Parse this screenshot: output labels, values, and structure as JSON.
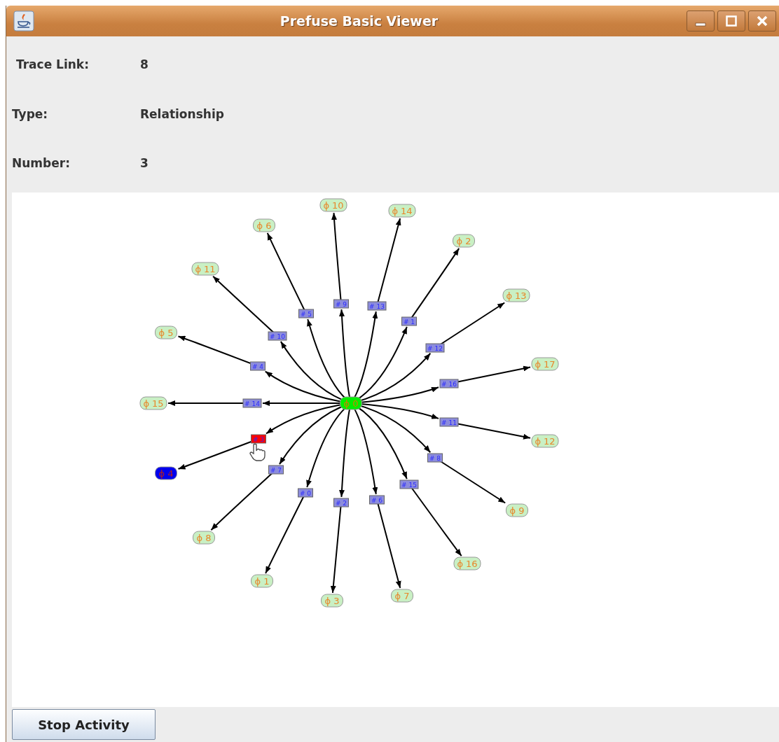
{
  "window": {
    "title": "Prefuse Basic Viewer"
  },
  "fields": [
    {
      "label": "Trace Link:",
      "value": "8"
    },
    {
      "label": "Type:",
      "value": "Relationship"
    },
    {
      "label": "Number:",
      "value": "3"
    }
  ],
  "graph": {
    "root": {
      "label": "ϕ 0",
      "kind": "root"
    },
    "nodes": [
      {
        "label": "ϕ 10",
        "highlighted": false,
        "edge": {
          "label": "# 9",
          "hovered": false
        }
      },
      {
        "label": "ϕ 14",
        "highlighted": false,
        "edge": {
          "label": "# 13",
          "hovered": false
        }
      },
      {
        "label": "ϕ 6",
        "highlighted": false,
        "edge": {
          "label": "# 5",
          "hovered": false
        }
      },
      {
        "label": "ϕ 2",
        "highlighted": false,
        "edge": {
          "label": "# 1",
          "hovered": false
        }
      },
      {
        "label": "ϕ 11",
        "highlighted": false,
        "edge": {
          "label": "# 10",
          "hovered": false
        }
      },
      {
        "label": "ϕ 13",
        "highlighted": false,
        "edge": {
          "label": "# 12",
          "hovered": false
        }
      },
      {
        "label": "ϕ 5",
        "highlighted": false,
        "edge": {
          "label": "# 4",
          "hovered": false
        }
      },
      {
        "label": "ϕ 17",
        "highlighted": false,
        "edge": {
          "label": "# 16",
          "hovered": false
        }
      },
      {
        "label": "ϕ 15",
        "highlighted": false,
        "edge": {
          "label": "# 14",
          "hovered": false
        }
      },
      {
        "label": "ϕ 12",
        "highlighted": false,
        "edge": {
          "label": "# 11",
          "hovered": false
        }
      },
      {
        "label": "ϕ 4",
        "highlighted": true,
        "edge": {
          "label": "# 3",
          "hovered": true
        }
      },
      {
        "label": "ϕ 9",
        "highlighted": false,
        "edge": {
          "label": "# 8",
          "hovered": false
        }
      },
      {
        "label": "ϕ 8",
        "highlighted": false,
        "edge": {
          "label": "# 7",
          "hovered": false
        }
      },
      {
        "label": "ϕ 16",
        "highlighted": false,
        "edge": {
          "label": "# 15",
          "hovered": false
        }
      },
      {
        "label": "ϕ 1",
        "highlighted": false,
        "edge": {
          "label": "# 0",
          "hovered": false
        }
      },
      {
        "label": "ϕ 3",
        "highlighted": false,
        "edge": {
          "label": "# 2",
          "hovered": false
        }
      },
      {
        "label": "ϕ 7",
        "highlighted": false,
        "edge": {
          "label": "# 6",
          "hovered": false
        }
      }
    ]
  },
  "buttons": [
    {
      "label": "Stop Activity"
    }
  ]
}
